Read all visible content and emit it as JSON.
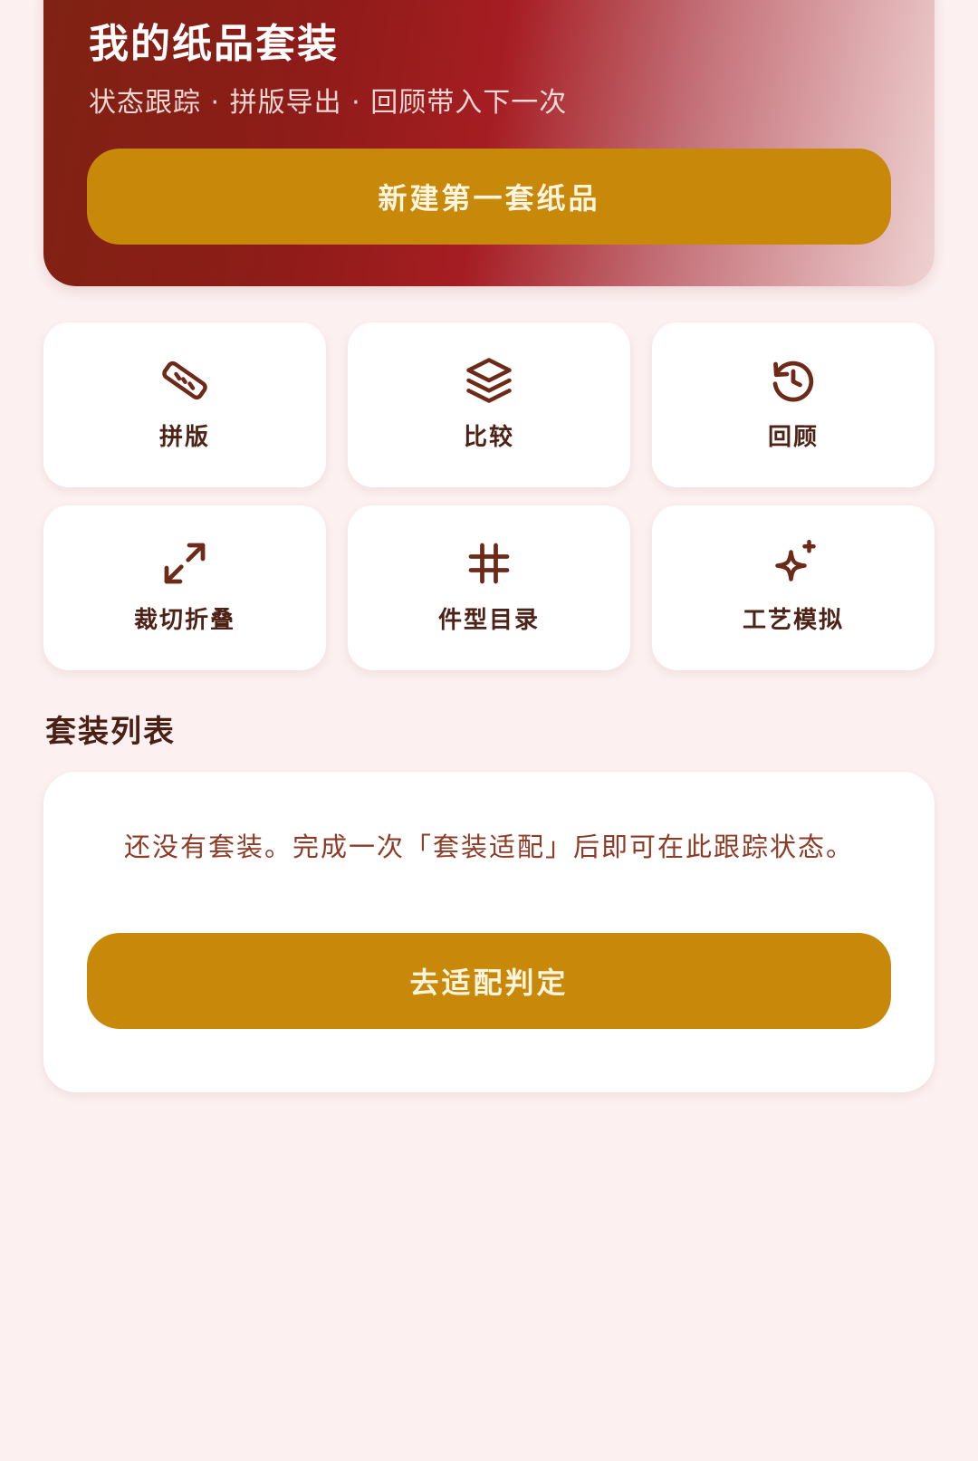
{
  "hero": {
    "title": "我的纸品套装",
    "subtitle": "状态跟踪 · 拼版导出 · 回顾带入下一次",
    "primary_button": "新建第一套纸品"
  },
  "tools": [
    {
      "label": "拼版",
      "icon": "ruler-icon"
    },
    {
      "label": "比较",
      "icon": "layers-icon"
    },
    {
      "label": "回顾",
      "icon": "history-icon"
    },
    {
      "label": "裁切折叠",
      "icon": "expand-arrows-icon"
    },
    {
      "label": "件型目录",
      "icon": "hash-icon"
    },
    {
      "label": "工艺模拟",
      "icon": "sparkle-icon"
    }
  ],
  "sets_section": {
    "title": "套装列表",
    "empty_message": "还没有套装。完成一次「套装适配」后即可在此跟踪状态。",
    "action_button": "去适配判定"
  },
  "colors": {
    "background": "#fcf0f0",
    "accent": "#c8880a",
    "hero_dark": "#8e1c18",
    "icon": "#6e2a18"
  }
}
